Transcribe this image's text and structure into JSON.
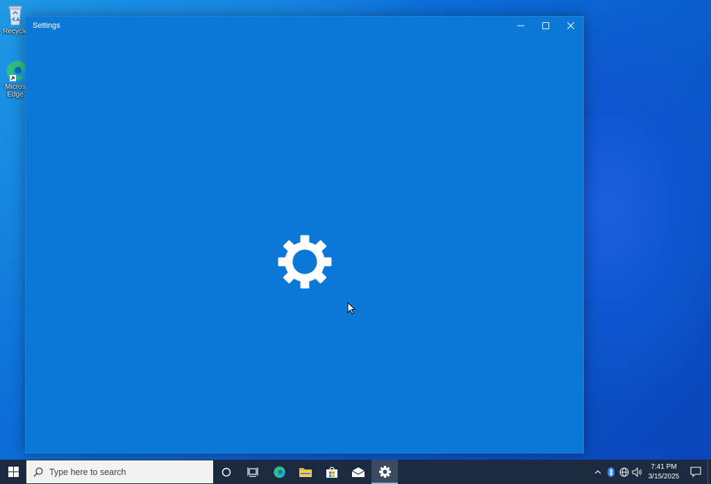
{
  "desktop": {
    "icons": [
      {
        "label": "Recycle Bin",
        "visible_label": "Recycle"
      },
      {
        "label": "Microsoft Edge",
        "visible_label_line1": "Micros",
        "visible_label_line2": "Edge"
      }
    ]
  },
  "window": {
    "title": "Settings",
    "controls": {
      "minimize": "minimize-icon",
      "maximize": "maximize-icon",
      "close": "close-icon"
    },
    "background_color": "#0a78d7"
  },
  "taskbar": {
    "search": {
      "placeholder": "Type here to search"
    },
    "pinned": [
      {
        "name": "cortana",
        "icon": "circle-icon"
      },
      {
        "name": "task-view",
        "icon": "task-view-icon"
      },
      {
        "name": "edge",
        "icon": "edge-icon"
      },
      {
        "name": "file-explorer",
        "icon": "folder-icon"
      },
      {
        "name": "store",
        "icon": "store-bag-icon"
      },
      {
        "name": "mail",
        "icon": "mail-icon"
      },
      {
        "name": "settings",
        "icon": "gear-icon",
        "active": true
      }
    ],
    "tray": {
      "time": "7:41 PM",
      "date": "3/15/2025"
    }
  },
  "colors": {
    "taskbar": "#1c2a3f",
    "accent": "#0a78d7"
  }
}
